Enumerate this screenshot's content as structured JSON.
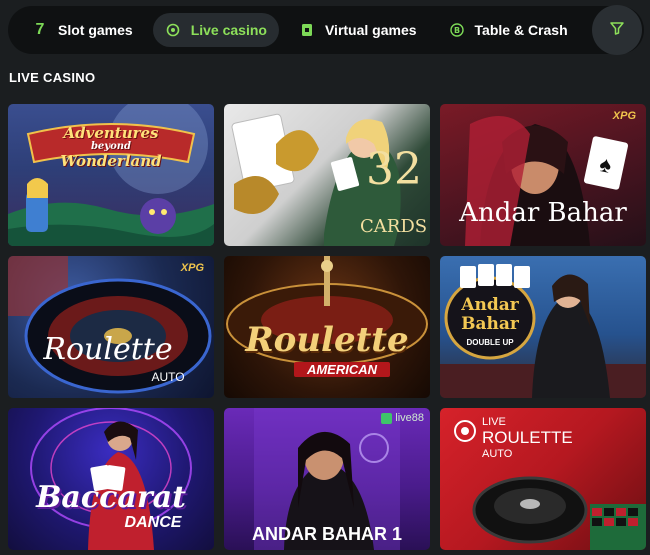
{
  "tabs": [
    {
      "label": "Slot games",
      "icon": "seven-icon"
    },
    {
      "label": "Live casino",
      "icon": "live-icon"
    },
    {
      "label": "Virtual games",
      "icon": "virtual-icon"
    },
    {
      "label": "Table & Crash",
      "icon": "table-icon"
    }
  ],
  "section_title": "LIVE CASINO",
  "games": [
    {
      "title_line1": "Adventures",
      "title_line2": "beyond",
      "title_line3": "Wonderland"
    },
    {
      "number": "32",
      "word": "CARDS"
    },
    {
      "title": "Andar Bahar",
      "provider": "XPG"
    },
    {
      "title": "Roulette",
      "subtitle": "AUTO",
      "provider": "XPG"
    },
    {
      "title": "Roulette",
      "subtitle": "AMERICAN"
    },
    {
      "title_line1": "Andar",
      "title_line2": "Bahar",
      "subtitle": "DOUBLE UP"
    },
    {
      "title": "Baccarat",
      "subtitle": "DANCE"
    },
    {
      "title": "ANDAR BAHAR 1",
      "provider": "live88"
    },
    {
      "prefix": "LIVE",
      "title": "ROULETTE",
      "subtitle": "AUTO"
    }
  ]
}
